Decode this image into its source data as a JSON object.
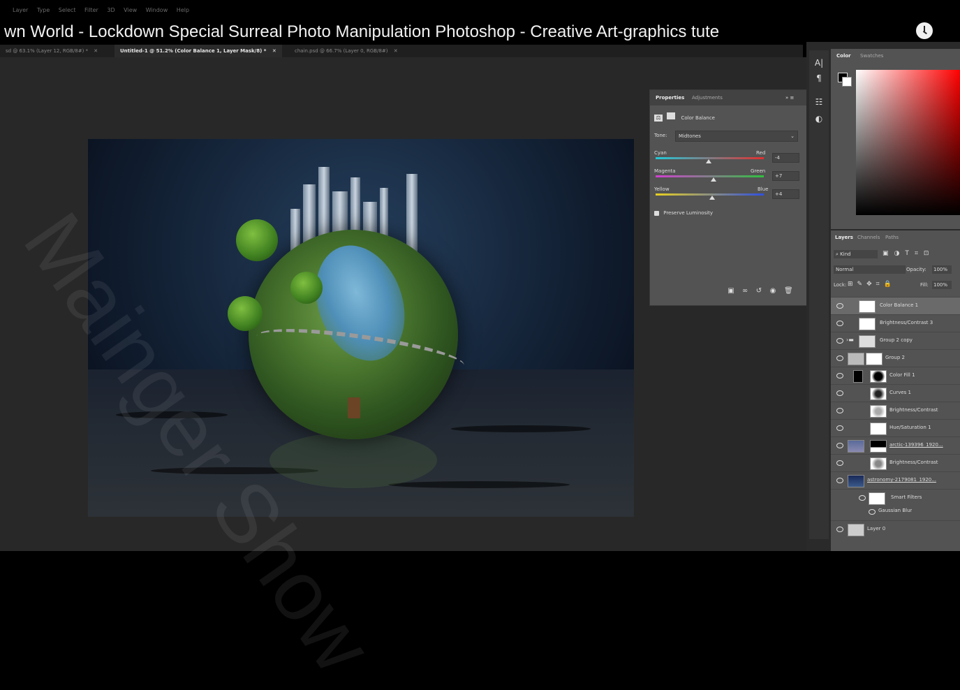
{
  "video": {
    "title": "wn World - Lockdown Special Surreal Photo Manipulation Photoshop - Creative Art-graphics tute",
    "watermark": "Mainger Show"
  },
  "menu": [
    "Layer",
    "Type",
    "Select",
    "Filter",
    "3D",
    "View",
    "Window",
    "Help"
  ],
  "doc_tabs": [
    {
      "label": "sd @ 63.1% (Layer 12, RGB/8#) *",
      "active": false
    },
    {
      "label": "Untitled-1 @ 51.2% (Color Balance 1, Layer Mask/8) *",
      "active": true
    },
    {
      "label": "chain.psd @ 66.7% (Layer 0, RGB/8#)",
      "active": false
    }
  ],
  "properties": {
    "tabs": [
      "Properties",
      "Adjustments"
    ],
    "adjustment_name": "Color Balance",
    "tone_label": "Tone:",
    "tone_value": "Midtones",
    "sliders": [
      {
        "left": "Cyan",
        "right": "Red",
        "value": "-4",
        "color_left": "#22c8d8",
        "color_right": "#e03030"
      },
      {
        "left": "Magenta",
        "right": "Green",
        "value": "+7",
        "color_left": "#d040d0",
        "color_right": "#30c040"
      },
      {
        "left": "Yellow",
        "right": "Blue",
        "value": "+4",
        "color_left": "#e8d020",
        "color_right": "#3050e0"
      }
    ],
    "preserve_luminosity": "Preserve Luminosity"
  },
  "color_panel": {
    "tabs": [
      "Color",
      "Swatches"
    ]
  },
  "layers_panel": {
    "tabs": [
      "Layers",
      "Channels",
      "Paths"
    ],
    "filter": "Kind",
    "blend_mode": "Normal",
    "opacity_label": "Opacity:",
    "opacity": "100%",
    "lock_label": "Lock:",
    "fill_label": "Fill:",
    "fill": "100%",
    "layers": [
      {
        "name": "Color Balance 1",
        "selected": true
      },
      {
        "name": "Brightness/Contrast 3",
        "selected": false
      },
      {
        "name": "Group 2 copy",
        "selected": false
      },
      {
        "name": "Group 2",
        "selected": false
      },
      {
        "name": "Color Fill 1",
        "selected": false
      },
      {
        "name": "Curves 1",
        "selected": false
      },
      {
        "name": "Brightness/Contrast",
        "selected": false
      },
      {
        "name": "Hue/Saturation 1",
        "selected": false
      },
      {
        "name": "arctic-139396_1920...",
        "selected": false
      },
      {
        "name": "Brightness/Contrast",
        "selected": false
      },
      {
        "name": "astronomy-2179081_1920...",
        "selected": false
      },
      {
        "name": "Smart Filters",
        "selected": false
      },
      {
        "name": "Gaussian Blur",
        "selected": false
      },
      {
        "name": "Layer 0",
        "selected": false
      }
    ]
  }
}
